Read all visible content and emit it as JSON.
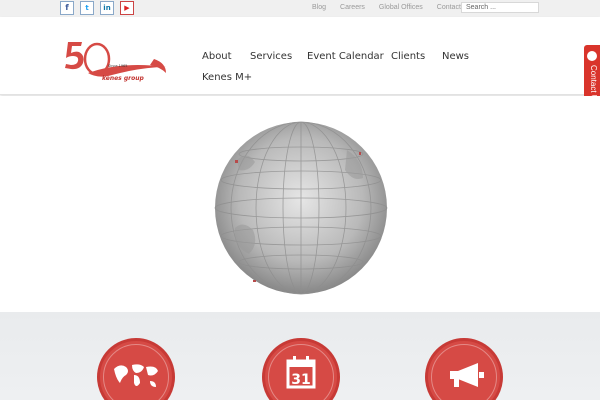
{
  "topbar": {
    "social": [
      {
        "name": "facebook",
        "glyph": "f"
      },
      {
        "name": "twitter",
        "glyph": "t"
      },
      {
        "name": "linkedin",
        "glyph": "in"
      },
      {
        "name": "youtube",
        "glyph": "▶"
      }
    ],
    "links": [
      "Blog",
      "Careers",
      "Global Offices",
      "Contact Us"
    ],
    "search_placeholder": "Search ..."
  },
  "logo": {
    "number": "50",
    "since": "Since 1965",
    "brand": "kenes group"
  },
  "nav": {
    "items": [
      "About",
      "Services",
      "Event Calendar",
      "Clients",
      "News",
      "Kenes M+"
    ]
  },
  "contact_tab": {
    "label": "Contact Us"
  },
  "features": {
    "icons": [
      "world-map-icon",
      "calendar-icon",
      "megaphone-icon"
    ],
    "calendar_day": "31"
  },
  "colors": {
    "brand_red": "#d64a45",
    "topbar_bg": "#f0f0f0",
    "nav_text": "#333333"
  }
}
